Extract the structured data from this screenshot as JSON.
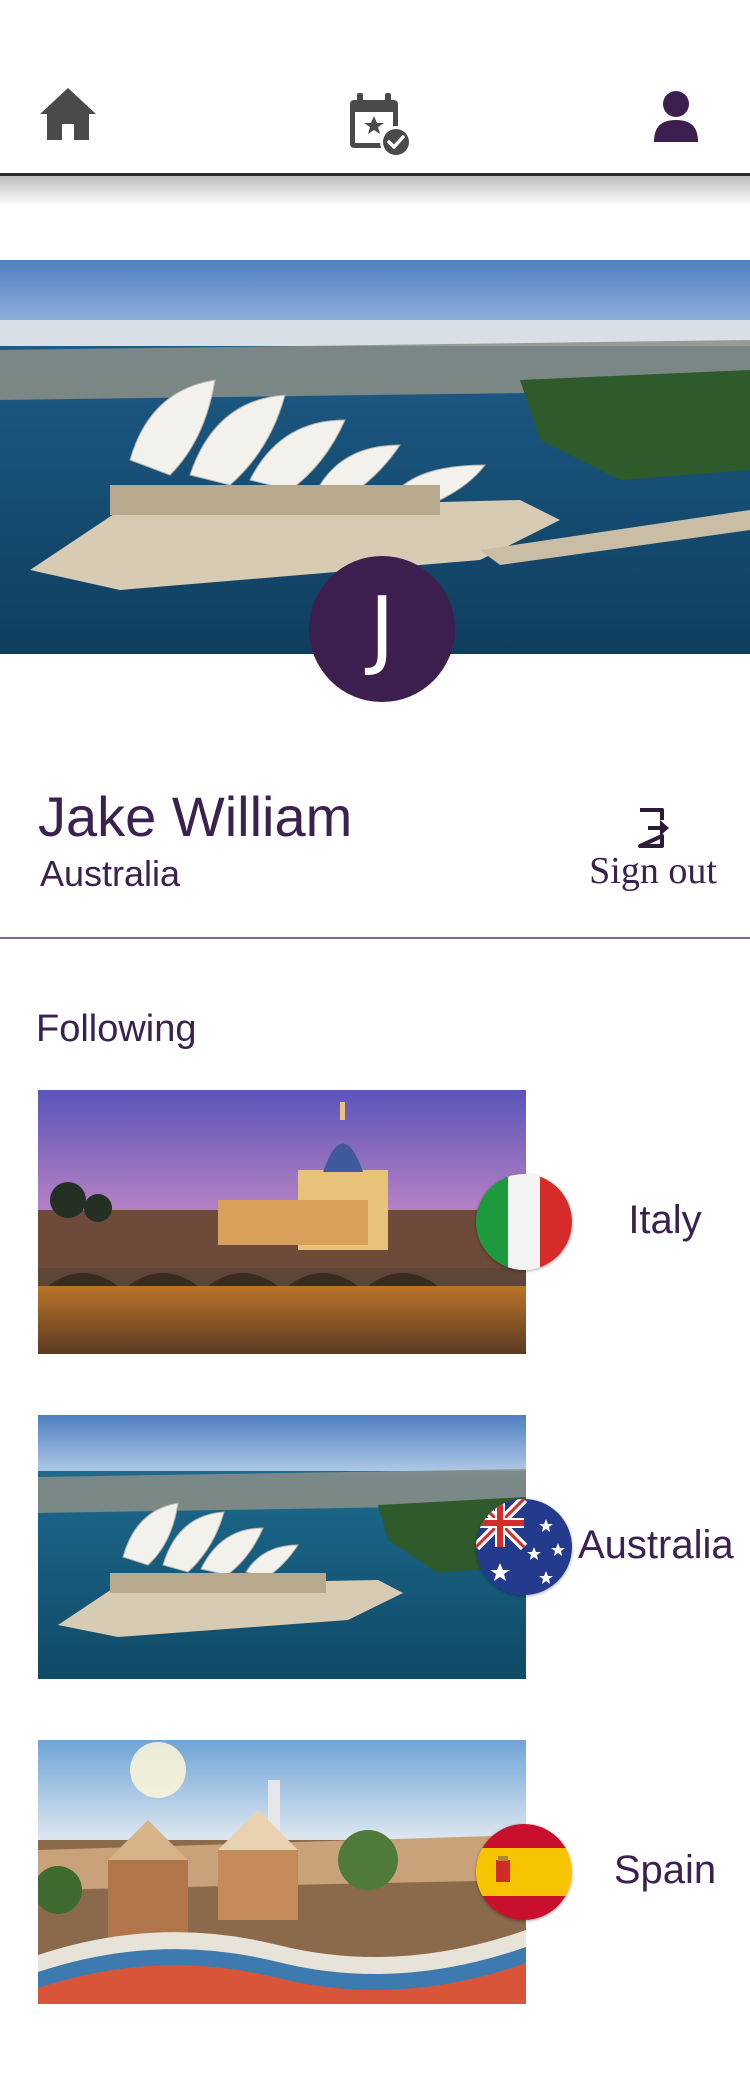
{
  "nav": {
    "items": [
      {
        "icon": "home-icon"
      },
      {
        "icon": "calendar-check-icon"
      },
      {
        "icon": "user-icon"
      }
    ],
    "colors": {
      "inactive": "#4a4a4a",
      "active": "#3c1f4f"
    }
  },
  "profile": {
    "avatar_initial": "J",
    "name": "Jake William",
    "country": "Australia",
    "signout_label": "Sign out"
  },
  "following": {
    "title": "Following",
    "items": [
      {
        "label": "Italy",
        "flag": "italy-flag"
      },
      {
        "label": "Australia",
        "flag": "australia-flag"
      },
      {
        "label": "Spain",
        "flag": "spain-flag"
      }
    ]
  },
  "colors": {
    "brand": "#3c1f4f",
    "text": "#3a2150"
  }
}
